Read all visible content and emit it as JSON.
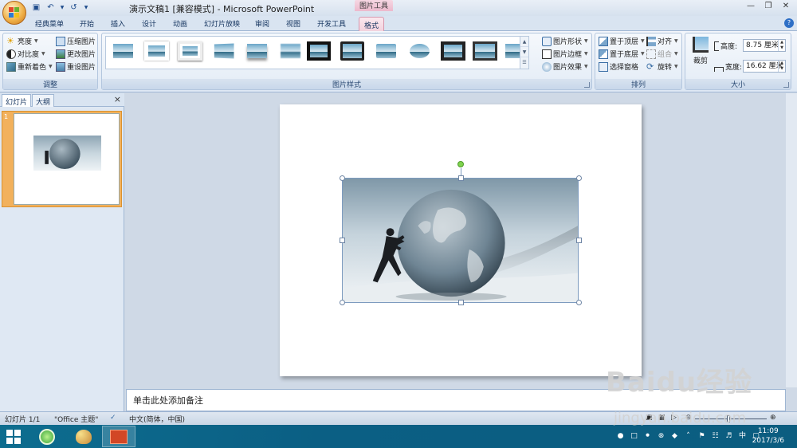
{
  "app": {
    "title": "演示文稿1 [兼容模式] - Microsoft PowerPoint",
    "contextual_tab_group": "图片工具"
  },
  "ribbon_tabs": [
    "经典菜单",
    "开始",
    "插入",
    "设计",
    "动画",
    "幻灯片放映",
    "审阅",
    "视图",
    "开发工具",
    "格式"
  ],
  "active_tab": "格式",
  "ribbon": {
    "adjust": {
      "label": "调整",
      "brightness": "亮度",
      "contrast": "对比度",
      "recolor": "重新着色",
      "compress": "压缩图片",
      "change_picture": "更改图片",
      "reset_picture": "重设图片"
    },
    "picture_styles": {
      "label": "图片样式",
      "shape": "图片形状",
      "border": "图片边框",
      "effects": "图片效果"
    },
    "arrange": {
      "label": "排列",
      "bring_front": "置于顶层",
      "send_back": "置于底层",
      "selection_pane": "选择窗格",
      "align": "对齐",
      "group": "组合",
      "rotate": "旋转"
    },
    "size": {
      "label": "大小",
      "crop": "裁剪",
      "height_label": "高度:",
      "height_value": "8.75 厘米",
      "width_label": "宽度:",
      "width_value": "16.62 厘米"
    }
  },
  "left_pane": {
    "tab_slides": "幻灯片",
    "tab_outline": "大纲",
    "close": "×",
    "slide_number": "1"
  },
  "notes": {
    "placeholder": "单击此处添加备注"
  },
  "status_bar": {
    "slide_info": "幻灯片 1/1",
    "theme": "\"Office 主题\"",
    "language": "中文(简体，中国)"
  },
  "taskbar": {
    "time": "11:09",
    "date": "2017/3/6",
    "ime": "中"
  },
  "watermark": {
    "brand": "Baidu经验",
    "url": "jingyan.baidu.com"
  },
  "colors": {
    "accent_tab": "#f2d2de",
    "taskbar": "#0b5f84",
    "thumb_selected": "#f2b15c"
  }
}
